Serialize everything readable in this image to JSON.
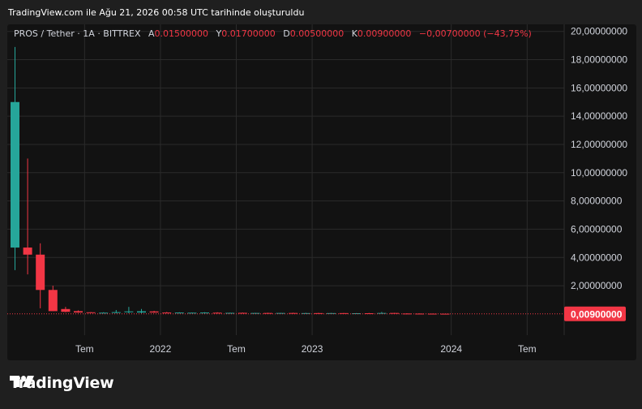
{
  "caption": "TradingView.com ile Ağu 21, 2026 00:58 UTC tarihinde oluşturuldu",
  "legend": {
    "symbol": "PROS / Tether · 1A · BITTREX",
    "open_label": "A",
    "open": "0.01500000",
    "high_label": "Y",
    "high": "0.01700000",
    "low_label": "D",
    "low": "0.00500000",
    "close_label": "K",
    "close": "0.00900000",
    "change": "−0,00700000 (−43,75%)"
  },
  "brand": "TradingView",
  "colors": {
    "up": "#26a69a",
    "down": "#f23645",
    "grid": "#2b2b2b",
    "axis_text": "#d1d4dc"
  },
  "chart_data": {
    "type": "candlestick",
    "ylim": [
      -1.5,
      20.5
    ],
    "y_ticks": [
      {
        "value": 20,
        "label": "20,00000000"
      },
      {
        "value": 18,
        "label": "18,00000000"
      },
      {
        "value": 16,
        "label": "16,00000000"
      },
      {
        "value": 14,
        "label": "14,00000000"
      },
      {
        "value": 12,
        "label": "12,00000000"
      },
      {
        "value": 10,
        "label": "10,00000000"
      },
      {
        "value": 8,
        "label": "8,00000000"
      },
      {
        "value": 6,
        "label": "6,00000000"
      },
      {
        "value": 4,
        "label": "4,00000000"
      },
      {
        "value": 2,
        "label": "2,00000000"
      }
    ],
    "x_ticks": [
      {
        "index": 5.5,
        "label": "Tem"
      },
      {
        "index": 11.5,
        "label": "2022"
      },
      {
        "index": 17.5,
        "label": "Tem"
      },
      {
        "index": 23.5,
        "label": "2023"
      },
      {
        "index": 34.5,
        "label": "2024"
      },
      {
        "index": 40.5,
        "label": "Tem"
      }
    ],
    "last_price": {
      "value": 0.009,
      "label": "0,00900000"
    },
    "candles": [
      {
        "o": 4.7,
        "h": 18.9,
        "l": 3.1,
        "c": 15.0
      },
      {
        "o": 4.7,
        "h": 11.0,
        "l": 2.8,
        "c": 4.2
      },
      {
        "o": 4.2,
        "h": 5.0,
        "l": 0.4,
        "c": 1.7
      },
      {
        "o": 1.7,
        "h": 2.0,
        "l": 0.2,
        "c": 0.2
      },
      {
        "o": 0.35,
        "h": 0.5,
        "l": 0.12,
        "c": 0.15
      },
      {
        "o": 0.2,
        "h": 0.25,
        "l": 0.08,
        "c": 0.1
      },
      {
        "o": 0.12,
        "h": 0.14,
        "l": 0.07,
        "c": 0.09
      },
      {
        "o": 0.07,
        "h": 0.12,
        "l": 0.05,
        "c": 0.09
      },
      {
        "o": 0.09,
        "h": 0.28,
        "l": 0.06,
        "c": 0.13
      },
      {
        "o": 0.14,
        "h": 0.5,
        "l": 0.05,
        "c": 0.18
      },
      {
        "o": 0.1,
        "h": 0.35,
        "l": 0.05,
        "c": 0.19
      },
      {
        "o": 0.18,
        "h": 0.22,
        "l": 0.08,
        "c": 0.1
      },
      {
        "o": 0.1,
        "h": 0.14,
        "l": 0.06,
        "c": 0.08
      },
      {
        "o": 0.06,
        "h": 0.12,
        "l": 0.04,
        "c": 0.1
      },
      {
        "o": 0.07,
        "h": 0.1,
        "l": 0.05,
        "c": 0.09
      },
      {
        "o": 0.06,
        "h": 0.12,
        "l": 0.04,
        "c": 0.1
      },
      {
        "o": 0.09,
        "h": 0.12,
        "l": 0.04,
        "c": 0.06
      },
      {
        "o": 0.06,
        "h": 0.09,
        "l": 0.04,
        "c": 0.08
      },
      {
        "o": 0.08,
        "h": 0.1,
        "l": 0.04,
        "c": 0.06
      },
      {
        "o": 0.06,
        "h": 0.08,
        "l": 0.04,
        "c": 0.07
      },
      {
        "o": 0.07,
        "h": 0.09,
        "l": 0.04,
        "c": 0.05
      },
      {
        "o": 0.05,
        "h": 0.08,
        "l": 0.04,
        "c": 0.07
      },
      {
        "o": 0.07,
        "h": 0.09,
        "l": 0.04,
        "c": 0.05
      },
      {
        "o": 0.05,
        "h": 0.08,
        "l": 0.03,
        "c": 0.06
      },
      {
        "o": 0.06,
        "h": 0.08,
        "l": 0.03,
        "c": 0.04
      },
      {
        "o": 0.04,
        "h": 0.07,
        "l": 0.03,
        "c": 0.06
      },
      {
        "o": 0.06,
        "h": 0.07,
        "l": 0.03,
        "c": 0.04
      },
      {
        "o": 0.04,
        "h": 0.06,
        "l": 0.03,
        "c": 0.05
      },
      {
        "o": 0.05,
        "h": 0.07,
        "l": 0.03,
        "c": 0.04
      },
      {
        "o": 0.04,
        "h": 0.14,
        "l": 0.03,
        "c": 0.07
      },
      {
        "o": 0.07,
        "h": 0.08,
        "l": 0.02,
        "c": 0.03
      },
      {
        "o": 0.03,
        "h": 0.05,
        "l": 0.02,
        "c": 0.025
      },
      {
        "o": 0.025,
        "h": 0.04,
        "l": 0.015,
        "c": 0.02
      },
      {
        "o": 0.02,
        "h": 0.03,
        "l": 0.012,
        "c": 0.016
      },
      {
        "o": 0.016,
        "h": 0.017,
        "l": 0.005,
        "c": 0.009
      }
    ]
  }
}
